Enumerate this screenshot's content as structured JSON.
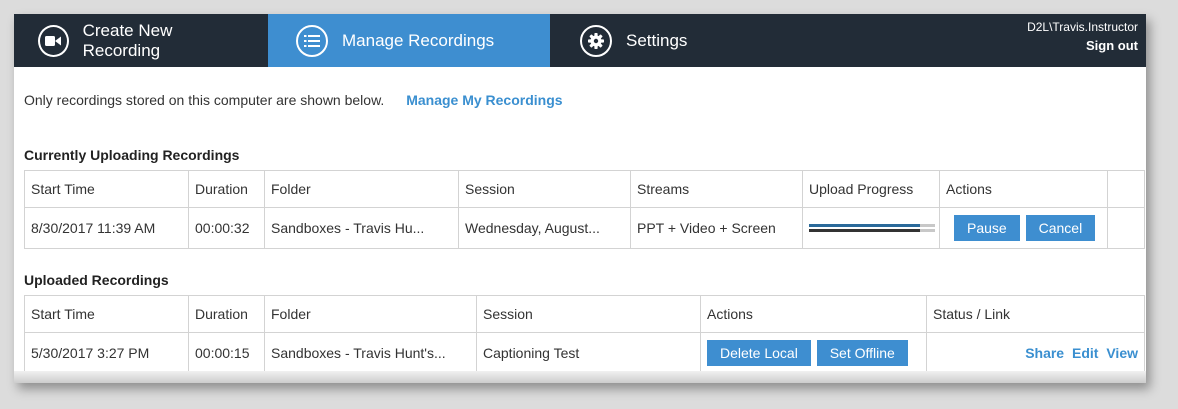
{
  "header": {
    "tabs": [
      {
        "label": "Create New Recording",
        "icon": "video-camera-icon"
      },
      {
        "label": "Manage Recordings",
        "icon": "list-icon"
      },
      {
        "label": "Settings",
        "icon": "gear-icon"
      }
    ],
    "user": "D2L\\Travis.Instructor",
    "sign_out": "Sign out"
  },
  "info": {
    "text": "Only recordings stored on this computer are shown below.",
    "link": "Manage My Recordings"
  },
  "uploading": {
    "title": "Currently Uploading Recordings",
    "columns": [
      "Start Time",
      "Duration",
      "Folder",
      "Session",
      "Streams",
      "Upload Progress",
      "Actions"
    ],
    "rows": [
      {
        "start_time": "8/30/2017 11:39 AM",
        "duration": "00:00:32",
        "folder": "Sandboxes - Travis Hu...",
        "session": "Wednesday, August...",
        "streams": "PPT + Video + Screen",
        "progress": 0.88,
        "pause": "Pause",
        "cancel": "Cancel"
      }
    ]
  },
  "uploaded": {
    "title": "Uploaded Recordings",
    "columns": [
      "Start Time",
      "Duration",
      "Folder",
      "Session",
      "Actions",
      "Status / Link"
    ],
    "rows": [
      {
        "start_time": "5/30/2017 3:27 PM",
        "duration": "00:00:15",
        "folder": "Sandboxes - Travis Hunt's...",
        "session": "Captioning Test",
        "delete_local": "Delete Local",
        "set_offline": "Set Offline",
        "share": "Share",
        "edit": "Edit",
        "view": "View"
      }
    ]
  },
  "colors": {
    "nav_bg": "#222c37",
    "accent": "#3e8ed0",
    "link": "#3a8fd0"
  }
}
